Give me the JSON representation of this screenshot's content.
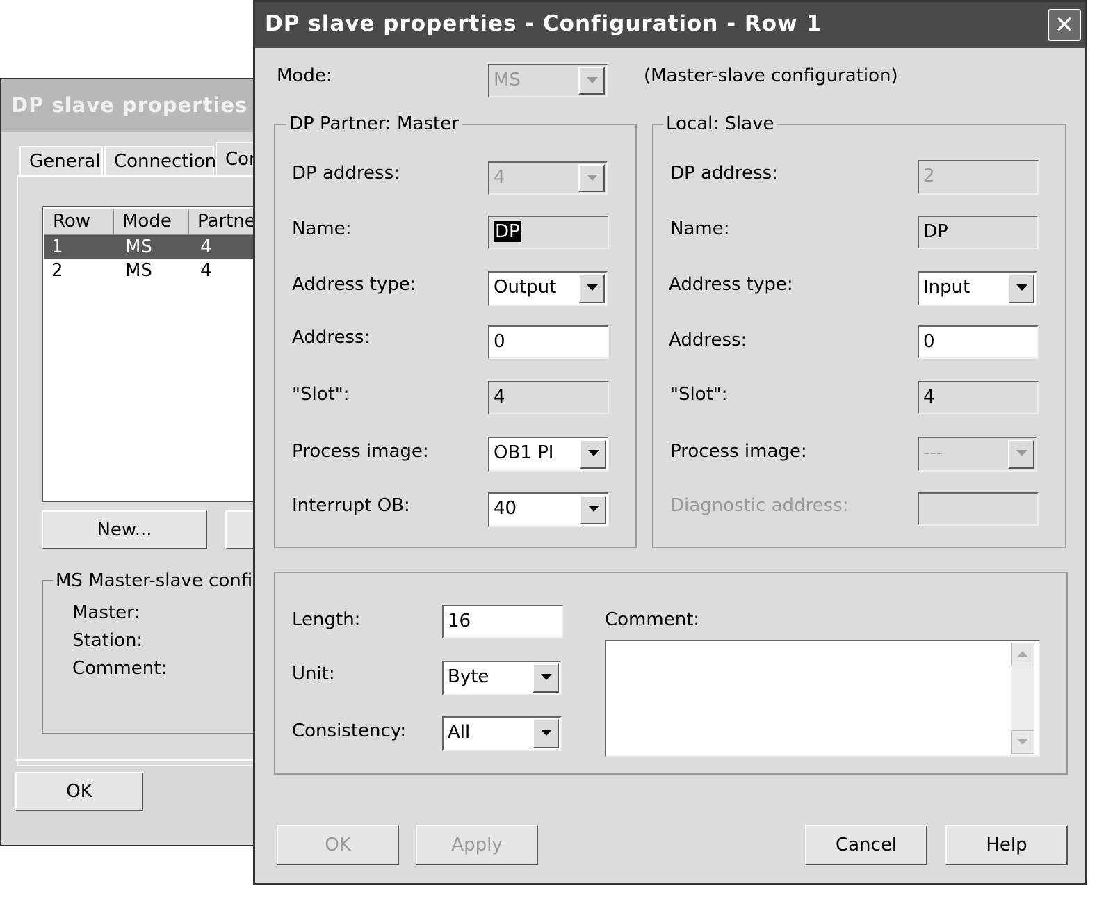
{
  "back_window": {
    "title": "DP slave properties",
    "tabs": [
      "General",
      "Connection",
      "Con"
    ],
    "columns": [
      "Row",
      "Mode",
      "Partne"
    ],
    "rows": [
      {
        "row": "1",
        "mode": "MS",
        "partner": "4"
      },
      {
        "row": "2",
        "mode": "MS",
        "partner": "4"
      }
    ],
    "new_button": "New...",
    "group_label": "MS Master-slave configu",
    "info_labels": [
      "Master:",
      "Station:",
      "Comment:"
    ],
    "ok_button": "OK"
  },
  "dialog": {
    "title": "DP slave properties - Configuration - Row 1",
    "close_glyph": "✕",
    "mode_label": "Mode:",
    "mode_value": "MS",
    "mode_description": "(Master-slave configuration)",
    "master": {
      "group_label": "DP Partner: Master",
      "dp_address_label": "DP address:",
      "dp_address_value": "4",
      "name_label": "Name:",
      "name_value": "DP",
      "address_type_label": "Address type:",
      "address_type_value": "Output",
      "address_label": "Address:",
      "address_value": "0",
      "slot_label": "\"Slot\":",
      "slot_value": "4",
      "process_image_label": "Process image:",
      "process_image_value": "OB1 PI",
      "interrupt_ob_label": "Interrupt OB:",
      "interrupt_ob_value": "40"
    },
    "slave": {
      "group_label": "Local: Slave",
      "dp_address_label": "DP address:",
      "dp_address_value": "2",
      "name_label": "Name:",
      "name_value": "DP",
      "address_type_label": "Address type:",
      "address_type_value": "Input",
      "address_label": "Address:",
      "address_value": "0",
      "slot_label": "\"Slot\":",
      "slot_value": "4",
      "process_image_label": "Process image:",
      "process_image_value": "---",
      "diag_address_label": "Diagnostic address:",
      "diag_address_value": ""
    },
    "bottom": {
      "length_label": "Length:",
      "length_value": "16",
      "unit_label": "Unit:",
      "unit_value": "Byte",
      "consistency_label": "Consistency:",
      "consistency_value": "All",
      "comment_label": "Comment:",
      "comment_value": ""
    },
    "buttons": {
      "ok": "OK",
      "apply": "Apply",
      "cancel": "Cancel",
      "help": "Help"
    }
  }
}
